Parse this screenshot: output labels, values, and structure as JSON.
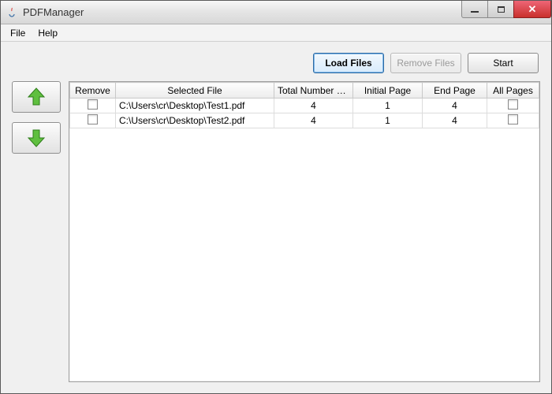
{
  "window": {
    "title": "PDFManager"
  },
  "menubar": {
    "file": "File",
    "help": "Help"
  },
  "toolbar": {
    "load_files": "Load Files",
    "remove_files": "Remove Files",
    "start": "Start"
  },
  "side": {
    "up": "move-up",
    "down": "move-down"
  },
  "table": {
    "columns": {
      "remove": "Remove",
      "file": "Selected File",
      "total": "Total Number of...",
      "initial": "Initial Page",
      "end": "End Page",
      "all": "All Pages"
    },
    "rows": [
      {
        "remove": false,
        "file": "C:\\Users\\cr\\Desktop\\Test1.pdf",
        "total": "4",
        "initial": "1",
        "end": "4",
        "all": false
      },
      {
        "remove": false,
        "file": "C:\\Users\\cr\\Desktop\\Test2.pdf",
        "total": "4",
        "initial": "1",
        "end": "4",
        "all": false
      }
    ]
  }
}
